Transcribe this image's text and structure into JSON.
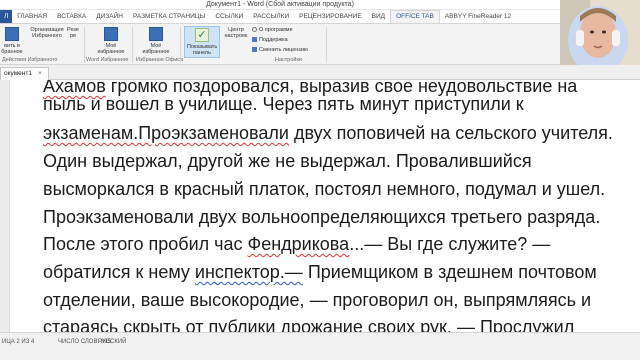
{
  "window": {
    "title": "Документ1 - Word (Сбой активации продукта)"
  },
  "tabs": [
    {
      "label": "Л",
      "type": "file"
    },
    {
      "label": "ГЛАВНАЯ"
    },
    {
      "label": "ВСТАВКА"
    },
    {
      "label": "ДИЗАЙН"
    },
    {
      "label": "РАЗМЕТКА СТРАНИЦЫ"
    },
    {
      "label": "ССЫЛКИ"
    },
    {
      "label": "РАССЫЛКИ"
    },
    {
      "label": "РЕЦЕНЗИРОВАНИЕ"
    },
    {
      "label": "ВИД"
    },
    {
      "label": "OFFICE TAB",
      "active": true
    },
    {
      "label": "ABBYY FineReader 12"
    }
  ],
  "ribbon": {
    "btn_add_1": "вить в",
    "btn_add_2": "бранное",
    "btn_org_1": "Организация",
    "btn_org_2": "Избранного",
    "btn_rez_1": "Резе",
    "btn_rez_2": "рв",
    "btn_word_fav_1": "Моё",
    "btn_word_fav_2": "избранное",
    "btn_office_fav_1": "Моё",
    "btn_office_fav_2": "избранное",
    "btn_show_panel_1": "Показывать",
    "btn_show_panel_2": "панель",
    "btn_center_1": "Центр",
    "btn_center_2": "настроек",
    "about": "О программе",
    "support": "Поддержка",
    "change_license": "Сменить лицензию",
    "group_fav_actions": "Действия Избранного",
    "group_word_fav": "Word Избранное",
    "group_office_fav": "Избранное Офиса",
    "group_settings": "Настройки"
  },
  "doctab": {
    "label": "окумент1",
    "close": "×"
  },
  "document": {
    "lines": [
      "Ахамов громко поздоровался, выразив свое неудовольствие на",
      "пыль и вошел в училище. Через пять минут приступили к",
      "экзаменам.Проэкзаменовали двух поповичей на сельского учителя.",
      "Один выдержал, другой же не выдержал. Провалившийся",
      "высморкался в красный платок, постоял немного, подумал и ушел.",
      "Проэкзаменовали двух вольноопределяющихся третьего разряда.",
      "После этого пробил час Фендрикова...— Вы где служите? —",
      "обратился к нему инспектор.— Приемщиком в здешнем почтовом",
      "отделении, ваше высокородие, — проговорил он, выпрямляясь и",
      "стараясь скрыть от публики дрожание своих рук. — Прослужил"
    ],
    "spell_red": [
      "Ахамов",
      "экзаменам.Проэкзаменовали",
      "Фендрикова"
    ],
    "spell_blue": [
      "инспектор.—"
    ]
  },
  "status": {
    "page": "ИЦА 2 ИЗ 4",
    "words": "ЧИСЛО СЛОВ: 895",
    "language": "РУССКИЙ"
  },
  "colors": {
    "accent": "#2b579a",
    "spell_error": "#d33333",
    "grammar_error": "#2b57c9"
  }
}
